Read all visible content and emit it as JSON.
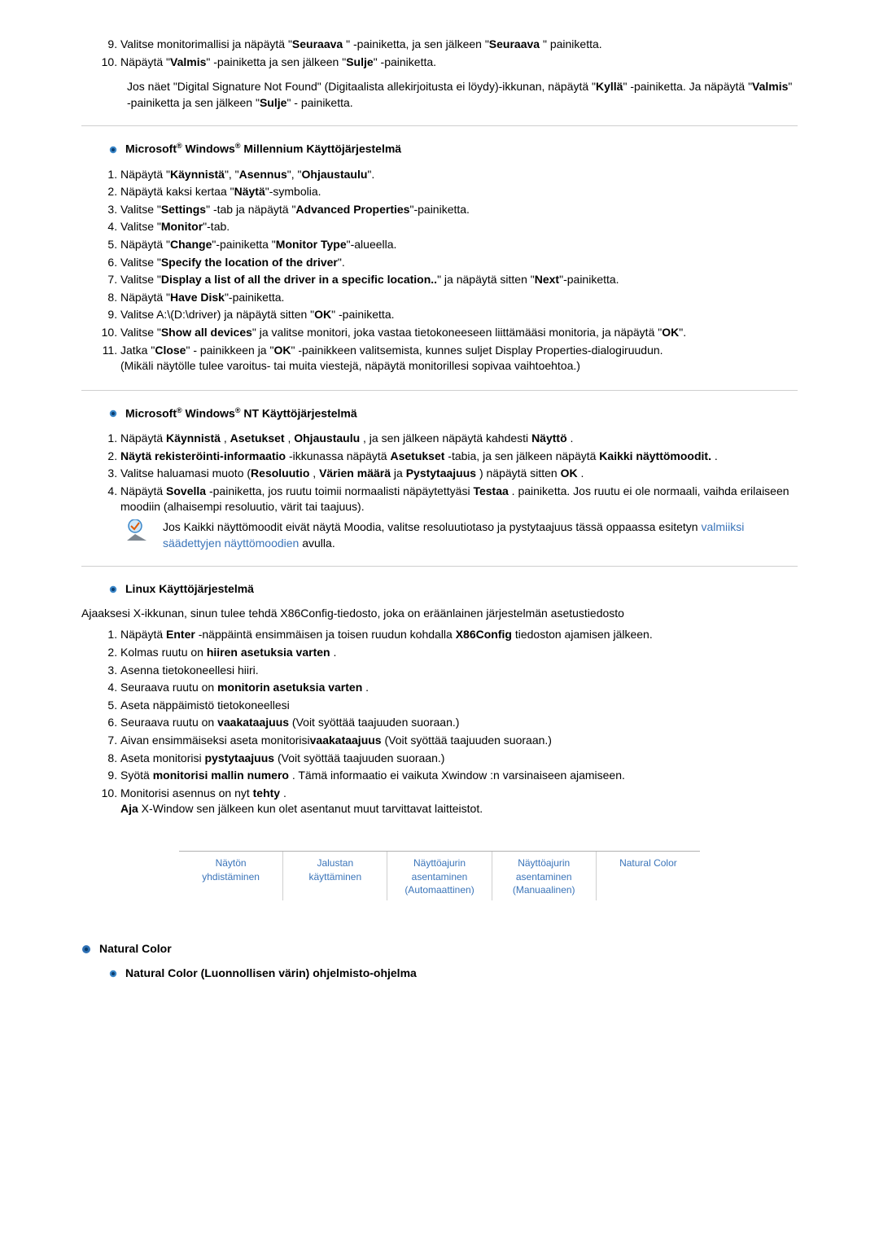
{
  "top_list": {
    "start": 9,
    "items": [
      "Valitse monitorimallisi ja näpäytä \"<b>Seuraava</b> \" -painiketta, ja sen jälkeen \"<b>Seuraava</b> \" painiketta.",
      "Näpäytä \"<b>Valmis</b>\" -painiketta ja sen jälkeen \"<b>Sulje</b>\" -painiketta."
    ],
    "note": "Jos näet \"Digital Signature Not Found\" (Digitaalista allekirjoitusta ei löydy)-ikkunan, näpäytä \"<b>Kyllä</b>\" -painiketta. Ja näpäytä \"<b>Valmis</b>\" -painiketta ja sen jälkeen \"<b>Sulje</b>\" - painiketta."
  },
  "me": {
    "heading_html": "Microsoft<sup>®</sup> Windows<sup>®</sup> Millennium Käyttöjärjestelmä",
    "items": [
      "Näpäytä \"<b>Käynnistä</b>\", \"<b>Asennus</b>\", \"<b>Ohjaustaulu</b>\".",
      "Näpäytä kaksi kertaa \"<b>Näytä</b>\"-symbolia.",
      "Valitse \"<b>Settings</b>\" -tab ja näpäytä \"<b>Advanced Properties</b>\"-painiketta.",
      "Valitse \"<b>Monitor</b>\"-tab.",
      "Näpäytä \"<b>Change</b>\"-painiketta \"<b>Monitor Type</b>\"-alueella.",
      "Valitse \"<b>Specify the location of the driver</b>\".",
      "Valitse \"<b>Display a list of all the driver in a specific location..</b>\" ja näpäytä sitten \"<b>Next</b>\"-painiketta.",
      "Näpäytä \"<b>Have Disk</b>\"-painiketta.",
      "Valitse A:\\(D:\\driver) ja näpäytä sitten \"<b>OK</b>\" -painiketta.",
      "Valitse \"<b>Show all devices</b>\" ja valitse monitori, joka vastaa tietokoneeseen liittämääsi monitoria, ja näpäytä \"<b>OK</b>\".",
      "Jatka \"<b>Close</b>\" - painikkeen ja \"<b>OK</b>\" -painikkeen valitsemista, kunnes suljet Display Properties-dialogiruudun.<br>(Mikäli näytölle tulee varoitus- tai muita viestejä, näpäytä monitorillesi sopivaa vaihtoehtoa.)"
    ]
  },
  "nt": {
    "heading_html": "Microsoft<sup>®</sup> Windows<sup>®</sup> NT Käyttöjärjestelmä",
    "items": [
      "Näpäytä <b>Käynnistä</b> , <b>Asetukset</b> , <b>Ohjaustaulu</b> , ja sen jälkeen näpäytä kahdesti <b>Näyttö</b> .",
      "<b>Näytä rekisteröinti-informaatio</b> -ikkunassa näpäytä <b>Asetukset</b> -tabia, ja sen jälkeen näpäytä <b>Kaikki näyttömoodit.</b> .",
      "Valitse haluamasi muoto (<b>Resoluutio</b> , <b>Värien määrä</b> ja <b>Pystytaajuus</b> ) näpäytä sitten <b>OK</b> .",
      "Näpäytä <b>Sovella</b> -painiketta, jos ruutu toimii normaalisti näpäytettyäsi <b>Testaa</b> . painiketta. Jos ruutu ei ole normaali, vaihda erilaiseen moodiin (alhaisempi resoluutio, värit tai taajuus)."
    ],
    "note": "Jos Kaikki näyttömoodit eivät näytä Moodia, valitse resoluutiotaso ja pystytaajuus tässä oppaassa esitetyn <span class=\"linktext\">valmiiksi säädettyjen näyttömoodien</span> avulla."
  },
  "linux": {
    "heading": "Linux Käyttöjärjestelmä",
    "intro": "Ajaaksesi X-ikkunan, sinun tulee tehdä X86Config-tiedosto, joka on eräänlainen järjestelmän asetustiedosto",
    "items": [
      "Näpäytä <b>Enter</b> -näppäintä ensimmäisen ja toisen ruudun kohdalla <b>X86Config</b> tiedoston ajamisen jälkeen.",
      "Kolmas ruutu on <b>hiiren asetuksia varten</b> .",
      "Asenna tietokoneellesi hiiri.",
      "Seuraava ruutu on <b>monitorin asetuksia varten</b> .",
      "Aseta näppäimistö tietokoneellesi",
      "Seuraava ruutu on <b>vaakataajuus</b> (Voit syöttää taajuuden suoraan.)",
      "Aivan ensimmäiseksi aseta monitorisi<b>vaakataajuus</b> (Voit syöttää taajuuden suoraan.)",
      "Aseta monitorisi <b>pystytaajuus</b> (Voit syöttää taajuuden suoraan.)",
      "Syötä <b>monitorisi mallin numero</b> . Tämä informaatio ei vaikuta Xwindow :n varsinaiseen ajamiseen.",
      "Monitorisi asennus on nyt <b>tehty</b> .<br><b>Aja</b> X-Window sen jälkeen kun olet asentanut muut tarvittavat laitteistot."
    ]
  },
  "tabs": [
    {
      "l1": "Näytön",
      "l2": "yhdistäminen"
    },
    {
      "l1": "Jalustan",
      "l2": "käyttäminen"
    },
    {
      "l1": "Näyttöajurin asentaminen",
      "l2": "(Automaattinen)"
    },
    {
      "l1": "Näyttöajurin asentaminen",
      "l2": "(Manuaalinen)"
    },
    {
      "l1": "Natural Color",
      "l2": ""
    }
  ],
  "natural_color": {
    "heading": "Natural Color",
    "sub": "Natural Color (Luonnollisen värin) ohjelmisto-ohjelma"
  }
}
